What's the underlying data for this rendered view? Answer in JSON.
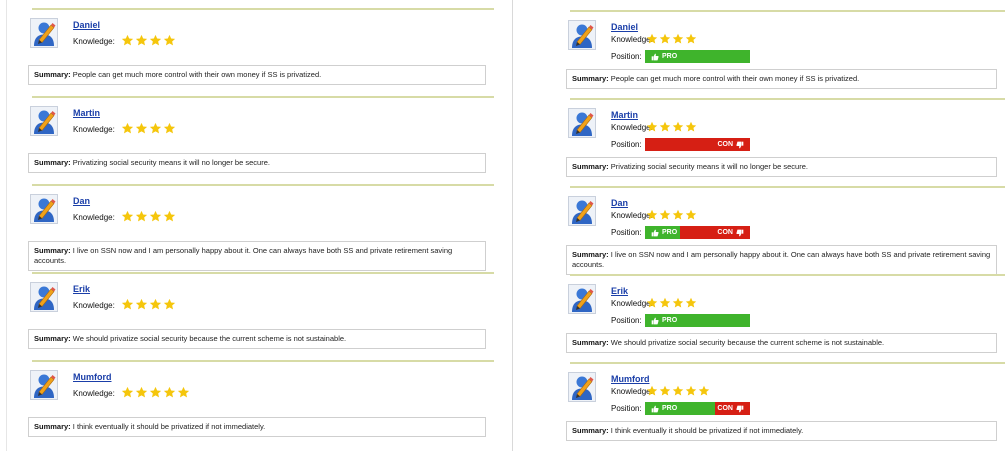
{
  "labels": {
    "knowledge": "Knowledge:",
    "position": "Position:",
    "summary_prefix": "Summary:",
    "pro": "PRO",
    "con": "CON"
  },
  "colors": {
    "name_link": "#1a3ea8",
    "star": "#f5c60c",
    "pro": "#3fb42c",
    "con": "#d61f14",
    "separator": "#d7dba6"
  },
  "icons": {
    "avatar": "user-avatar-pencil-icon",
    "star": "star-icon",
    "pro": "thumbs-up-icon",
    "con": "thumbs-down-icon"
  },
  "left": {
    "entries": [
      {
        "name": "Daniel",
        "stars": 4,
        "summary": "People can get much more control with their own money if SS is privatized."
      },
      {
        "name": "Martin",
        "stars": 4,
        "summary": "Privatizing social security means it will no longer be secure."
      },
      {
        "name": "Dan",
        "stars": 4,
        "summary": "I live on SSN now and I am personally happy about it. One can always have both SS and private retirement saving accounts."
      },
      {
        "name": "Erik",
        "stars": 4,
        "summary": "We should privatize social security because the current scheme is not sustainable."
      },
      {
        "name": "Mumford",
        "stars": 5,
        "summary": "I think eventually it should be privatized if not immediately."
      }
    ]
  },
  "right": {
    "entries": [
      {
        "name": "Daniel",
        "stars": 4,
        "position_pro_share": 1.0,
        "summary": "People can get much more control with their own money if SS is privatized."
      },
      {
        "name": "Martin",
        "stars": 4,
        "position_pro_share": 0.0,
        "summary": "Privatizing social security means it will no longer be secure."
      },
      {
        "name": "Dan",
        "stars": 4,
        "position_pro_share": 0.33,
        "summary": "I live on SSN now and I am personally happy about it. One can always have both SS and private retirement saving accounts."
      },
      {
        "name": "Erik",
        "stars": 4,
        "position_pro_share": 1.0,
        "summary": "We should privatize social security because the current scheme is not sustainable."
      },
      {
        "name": "Mumford",
        "stars": 5,
        "position_pro_share": 0.67,
        "summary": "I think eventually it should be privatized if not immediately."
      }
    ]
  }
}
